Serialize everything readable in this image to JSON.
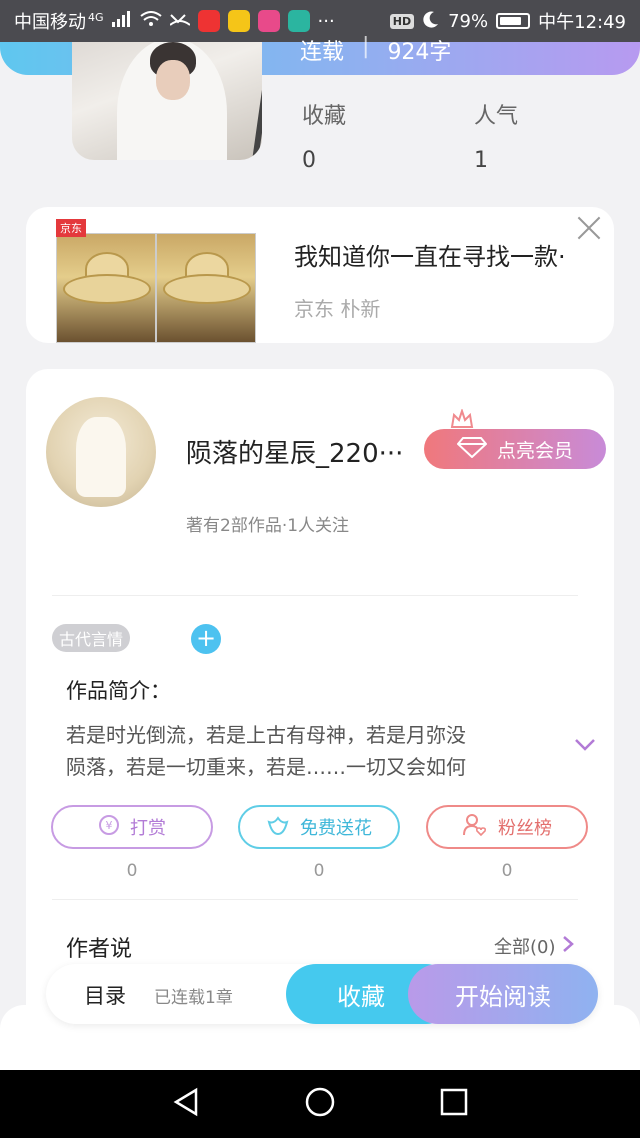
{
  "status_bar": {
    "carrier": "中国移动",
    "network": "4G",
    "hd": "HD",
    "battery": "79%",
    "battery_level": 0.79,
    "time": "中午12:49",
    "more": "···"
  },
  "book": {
    "status": "连载",
    "separator": "|",
    "words": "924字",
    "stats": [
      {
        "label": "收藏",
        "value": "0"
      },
      {
        "label": "人气",
        "value": "1"
      }
    ]
  },
  "ad": {
    "brand_tag": "京东",
    "title": "我知道你一直在寻找一款·",
    "source": "京东 朴新"
  },
  "author": {
    "name": "陨落的星辰_220···",
    "meta": "著有2部作品·1人关注",
    "vip_button": "点亮会员"
  },
  "tags": [
    "古代言情"
  ],
  "intro": {
    "heading": "作品简介：",
    "line1": "若是时光倒流，若是上古有母神，若是月弥没",
    "line2": "陨落，若是一切重来，若是……一切又会如何"
  },
  "actions": [
    {
      "label": "打赏",
      "count": "0",
      "icon": "yen-icon"
    },
    {
      "label": "免费送花",
      "count": "0",
      "icon": "flower-icon"
    },
    {
      "label": "粉丝榜",
      "count": "0",
      "icon": "user-heart-icon"
    }
  ],
  "author_say": {
    "heading": "作者说",
    "all": "全部(0)"
  },
  "bottom": {
    "toc": "目录",
    "toc_sub": "已连载1章",
    "favorite": "收藏",
    "read": "开始阅读"
  },
  "colors": {
    "accent_blue": "#45c9ee",
    "accent_purple": "#b99ae9",
    "vip_pink": "#f0787c"
  }
}
